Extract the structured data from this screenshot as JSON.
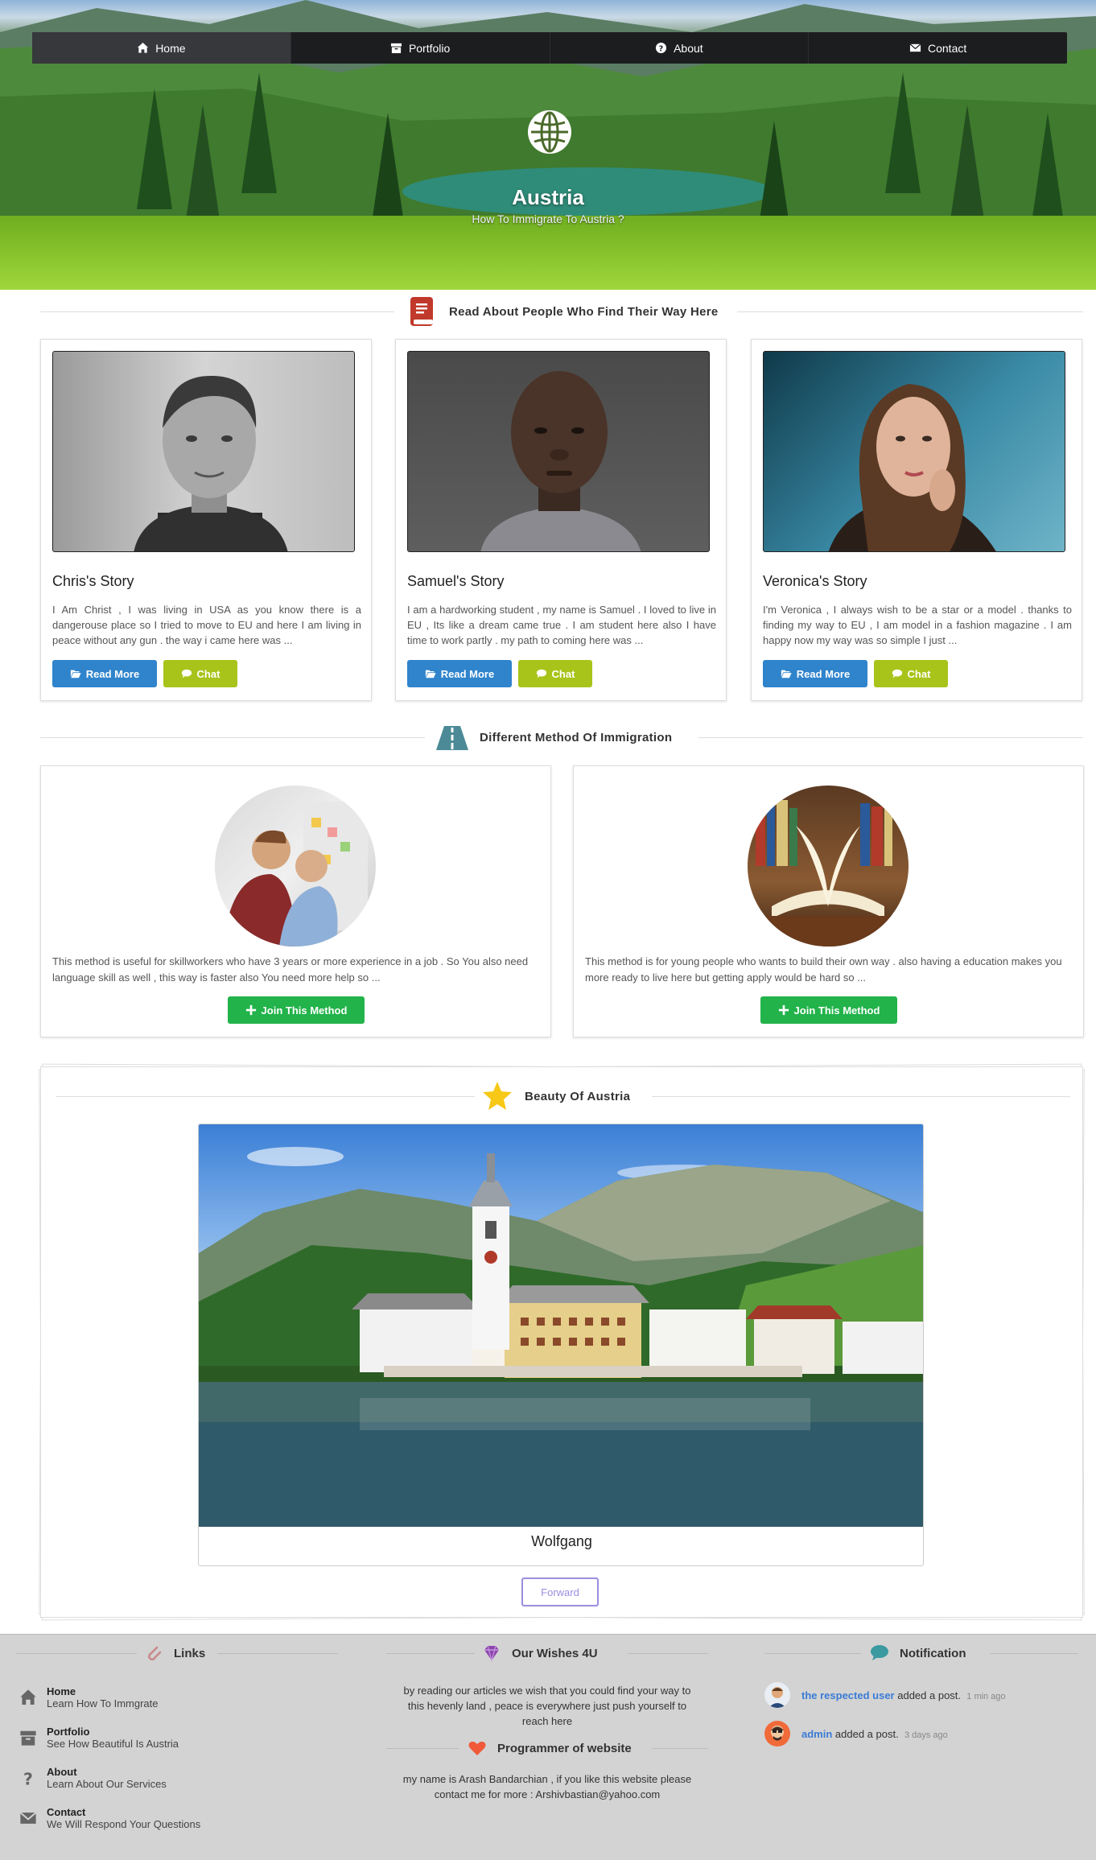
{
  "nav": {
    "items": [
      {
        "label": "Home",
        "icon": "home-icon",
        "active": true
      },
      {
        "label": "Portfolio",
        "icon": "archive-icon",
        "active": false
      },
      {
        "label": "About",
        "icon": "question-circle-icon",
        "active": false
      },
      {
        "label": "Contact",
        "icon": "envelope-icon",
        "active": false
      }
    ]
  },
  "hero": {
    "title": "Austria",
    "subtitle": "How To Immigrate To Austria ?",
    "icon": "globe-icon"
  },
  "stories_section": {
    "title": "Read About People Who Find Their Way Here",
    "icon": "book-icon",
    "cards": [
      {
        "name": "Chris's Story",
        "text": "I Am Christ , I was living in USA as you know there is a dangerouse place so I tried to move to EU and here I am living in peace without any gun . the way i came here was ...",
        "read_more": "Read More",
        "chat": "Chat"
      },
      {
        "name": "Samuel's Story",
        "text": "I am a hardworking student , my name is Samuel . I loved to live in EU , Its like a dream came true . I am student here also I have time to work partly . my path to coming here was ...",
        "read_more": "Read More",
        "chat": "Chat"
      },
      {
        "name": "Veronica's Story",
        "text": "I'm Veronica , I always wish to be a star or a model . thanks to finding my way to EU , I am model in a fashion magazine . I am happy now my way was so simple I just ...",
        "read_more": "Read More",
        "chat": "Chat"
      }
    ]
  },
  "methods_section": {
    "title": "Different Method Of Immigration",
    "icon": "road-icon",
    "cards": [
      {
        "text": "This method is useful for skillworkers who have 3 years or more experience in a job . So You also need language skill as well , this way is faster also You need more help so ...",
        "button": "Join This Method"
      },
      {
        "text": "This method is for young people who wants to build their own way . also having a education makes you more ready to live here but getting apply would be hard so ...",
        "button": "Join This Method"
      }
    ]
  },
  "beauty_section": {
    "title": "Beauty Of Austria",
    "icon": "star-icon",
    "caption": "Wolfgang",
    "forward": "Forward"
  },
  "footer": {
    "links": {
      "title": "Links",
      "icon": "paperclip-icon",
      "items": [
        {
          "title": "Home",
          "desc": "Learn How To Immgrate",
          "icon": "home-icon"
        },
        {
          "title": "Portfolio",
          "desc": "See How Beautiful Is Austria",
          "icon": "archive-icon"
        },
        {
          "title": "About",
          "desc": "Learn About Our Services",
          "icon": "question-icon"
        },
        {
          "title": "Contact",
          "desc": "We Will Respond Your Questions",
          "icon": "envelope-icon"
        }
      ]
    },
    "wishes": {
      "title": "Our Wishes 4U",
      "icon": "diamond-icon",
      "text": "by reading our articles we wish that you could find your way to this hevenly land , peace is everywhere just push yourself to reach here"
    },
    "programmer": {
      "title": "Programmer of website",
      "icon": "heart-icon",
      "text": "my name is Arash Bandarchian , if you like this website please contact me for more : Arshivbastian@yahoo.com"
    },
    "notification": {
      "title": "Notification",
      "icon": "comment-icon",
      "items": [
        {
          "user": "the respected user",
          "action": "added a post.",
          "time": "1 min ago"
        },
        {
          "user": "admin",
          "action": "added a post.",
          "time": "3 days ago"
        }
      ]
    }
  },
  "colors": {
    "nav_bg": "#1c1d1f",
    "read_more": "#2f84cc",
    "chat": "#a8c41a",
    "join": "#22b34a",
    "forward": "#9a8ee0",
    "footer_bg": "#d3d3d3",
    "link_blue": "#3a7bd5"
  }
}
